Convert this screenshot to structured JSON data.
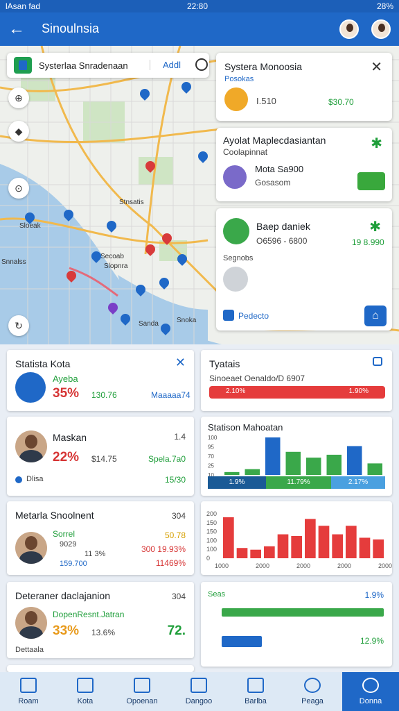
{
  "status_bar": {
    "left": "lAsan fad",
    "time": "22:80",
    "battery": "28%"
  },
  "app_bar": {
    "title": "Sinoulnsia"
  },
  "map": {
    "search": {
      "query": "Systerlaa Snradenaan",
      "add_label": "Addl"
    },
    "labels": [
      "Stnsatis",
      "Sloeak",
      "Secoab",
      "Slopnra",
      "Snnalss",
      "Sanda",
      "Snoka"
    ]
  },
  "panel1": {
    "title": "Systera Monoosia",
    "subtitle": "Posokas",
    "value": "I.510",
    "price": "$30.70"
  },
  "panel2": {
    "title": "Ayolat Maplecdasiantan",
    "subtitle": "Coolapinnat",
    "item": "Mota Sa900",
    "item_sub": "Gosasom"
  },
  "panel3": {
    "title": "Baep daniek",
    "sub": "O6596 - 6800",
    "price": "19 8.990",
    "note": "Segnobs",
    "link": "Pedecto"
  },
  "cards": {
    "stats_kota": {
      "title": "Statista Kota",
      "label": "Ayeba",
      "pct": "35%",
      "val": "130.76",
      "link": "Maaaaa74"
    },
    "tyatais": {
      "title": "Tyatais",
      "sub": "Sinoeaet Oenaldo/D 6907",
      "left": "2.10%",
      "right": "1.90%"
    },
    "maskan": {
      "title": "Maskan",
      "num": "1.4",
      "pct": "22%",
      "val": "$14.75",
      "right": "Spela.7a0",
      "foot": "Dlisa",
      "foot_val": "15/30"
    },
    "station": {
      "title": "Statison Mahoatan",
      "seg1": "1.9%",
      "seg2": "11.79%",
      "seg3": "2.17%"
    },
    "metana": {
      "title": "Metarla Snoolnent",
      "num": "304",
      "l1": "Sorrel",
      "l2": "9029",
      "l3": "11 3%",
      "l4": "159.700",
      "r1": "50.78",
      "r2": "300 19.93%",
      "r3": "11469%"
    },
    "deteran": {
      "title": "Deteraner daclajanion",
      "num": "304",
      "sub": "DopenResnt.Jatran",
      "pct": "33%",
      "val": "13.6%",
      "big": "72.",
      "foot": "Dettaala",
      "label": "Seas",
      "right_pct": "1.9%",
      "right_val": "12.9%"
    }
  },
  "chart_data": [
    {
      "type": "bar",
      "title": "Statison Mahoatan",
      "y_ticks": [
        "100",
        "95",
        "70",
        "25",
        "10"
      ],
      "values": [
        1,
        2,
        13,
        8,
        6,
        7,
        10,
        4
      ],
      "colors": [
        "#3aa84a",
        "#3aa84a",
        "#1f68c7",
        "#3aa84a",
        "#3aa84a",
        "#3aa84a",
        "#1f68c7",
        "#3aa84a"
      ]
    },
    {
      "type": "bar",
      "y_ticks": [
        "200",
        "150",
        "150",
        "100",
        "100",
        "0"
      ],
      "x_ticks": [
        "1000",
        "2000",
        "2000",
        "2000",
        "2000"
      ],
      "values": [
        240,
        60,
        50,
        70,
        140,
        130,
        230,
        190,
        140,
        190,
        120,
        110
      ],
      "ylim": [
        0,
        260
      ],
      "color": "#e53c3c"
    }
  ],
  "nav": [
    {
      "label": "Roam",
      "icon": "home-icon"
    },
    {
      "label": "Kota",
      "icon": "building-icon"
    },
    {
      "label": "Opoenan",
      "icon": "document-icon"
    },
    {
      "label": "Dangoo",
      "icon": "city-icon"
    },
    {
      "label": "Barlba",
      "icon": "list-icon"
    },
    {
      "label": "Peaga",
      "icon": "globe-icon"
    },
    {
      "label": "Donna",
      "icon": "user-icon"
    }
  ]
}
